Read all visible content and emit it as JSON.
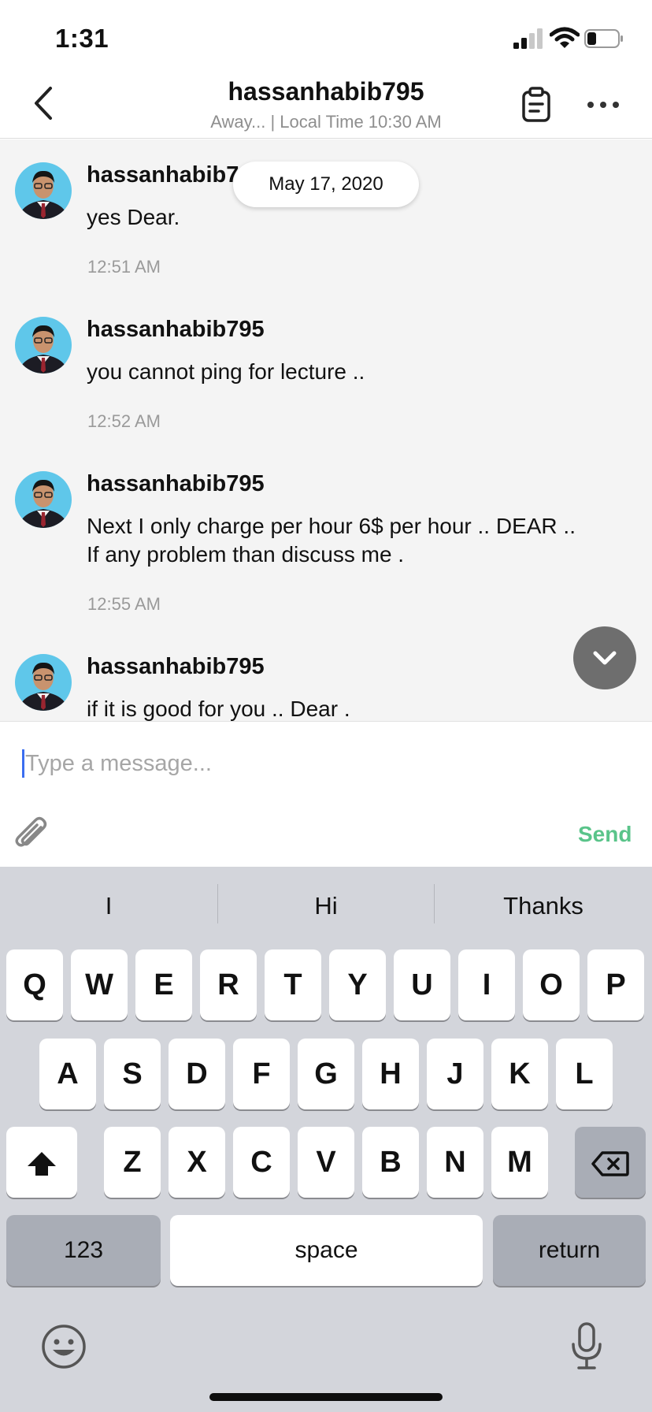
{
  "status": {
    "time": "1:31"
  },
  "header": {
    "title": "hassanhabib795",
    "subtitle": "Away... | Local Time 10:30 AM"
  },
  "date_pill": "May 17, 2020",
  "messages": [
    {
      "sender": "hassanhabib7",
      "text": "yes Dear.",
      "time": "12:51 AM"
    },
    {
      "sender": "hassanhabib795",
      "text": "you cannot ping  for lecture ..",
      "time": "12:52 AM"
    },
    {
      "sender": "hassanhabib795",
      "text_line1": "Next I  only charge per hour 6$ per hour ..  DEAR ..",
      "text_line2": "If any problem than discuss me .",
      "time": "12:55 AM"
    },
    {
      "sender": "hassanhabib795",
      "text": "if it is good for  you .. Dear ."
    }
  ],
  "composer": {
    "placeholder": "Type a message...",
    "value": "",
    "send_label": "Send",
    "send_color": "#5ac48a"
  },
  "keyboard": {
    "suggestions": [
      "I",
      "Hi",
      "Thanks"
    ],
    "row1": [
      "Q",
      "W",
      "E",
      "R",
      "T",
      "Y",
      "U",
      "I",
      "O",
      "P"
    ],
    "row2": [
      "A",
      "S",
      "D",
      "F",
      "G",
      "H",
      "J",
      "K",
      "L"
    ],
    "row3": [
      "Z",
      "X",
      "C",
      "V",
      "B",
      "N",
      "M"
    ],
    "numbers_label": "123",
    "space_label": "space",
    "return_label": "return"
  },
  "colors": {
    "avatar_bg": "#5fc7ea",
    "chat_bg": "#f4f4f4",
    "keyboard_bg": "#d3d5db"
  }
}
